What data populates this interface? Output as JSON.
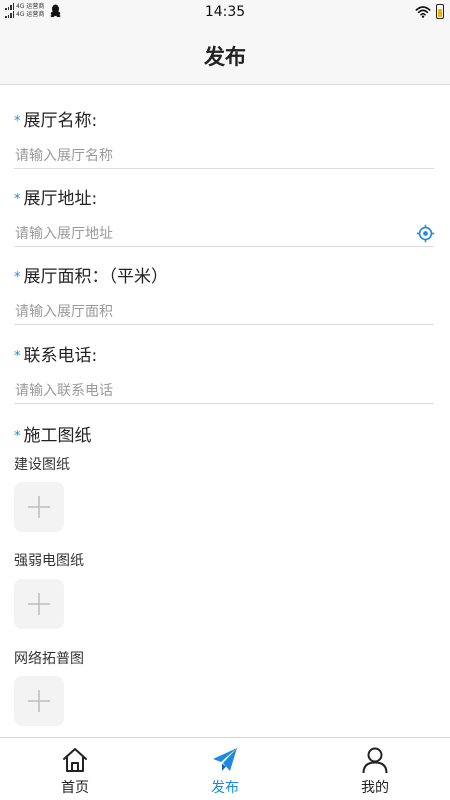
{
  "status_bar": {
    "carrier_line1": "4G 运营商",
    "carrier_line2": "4G 运营商",
    "time": "14:35"
  },
  "header": {
    "title": "发布"
  },
  "form": {
    "required_mark": "*",
    "fields": [
      {
        "label": "展厅名称:",
        "placeholder": "请输入展厅名称"
      },
      {
        "label": "展厅地址:",
        "placeholder": "请输入展厅地址",
        "icon": "location-icon"
      },
      {
        "label": "展厅面积：（平米）",
        "placeholder": "请输入展厅面积"
      },
      {
        "label": "联系电话:",
        "placeholder": "请输入联系电话"
      }
    ],
    "drawings": {
      "label": "施工图纸",
      "groups": [
        {
          "label": "建设图纸"
        },
        {
          "label": "强弱电图纸"
        },
        {
          "label": "网络拓普图"
        }
      ]
    }
  },
  "tabbar": {
    "tabs": [
      {
        "label": "首页",
        "icon": "home-icon",
        "active": false
      },
      {
        "label": "发布",
        "icon": "paper-plane-icon",
        "active": true
      },
      {
        "label": "我的",
        "icon": "user-icon",
        "active": false
      }
    ]
  },
  "colors": {
    "accent": "#1e88e5",
    "required": "#1e88e5",
    "divider": "#dcdcdc",
    "upload_bg": "#f3f3f3"
  }
}
